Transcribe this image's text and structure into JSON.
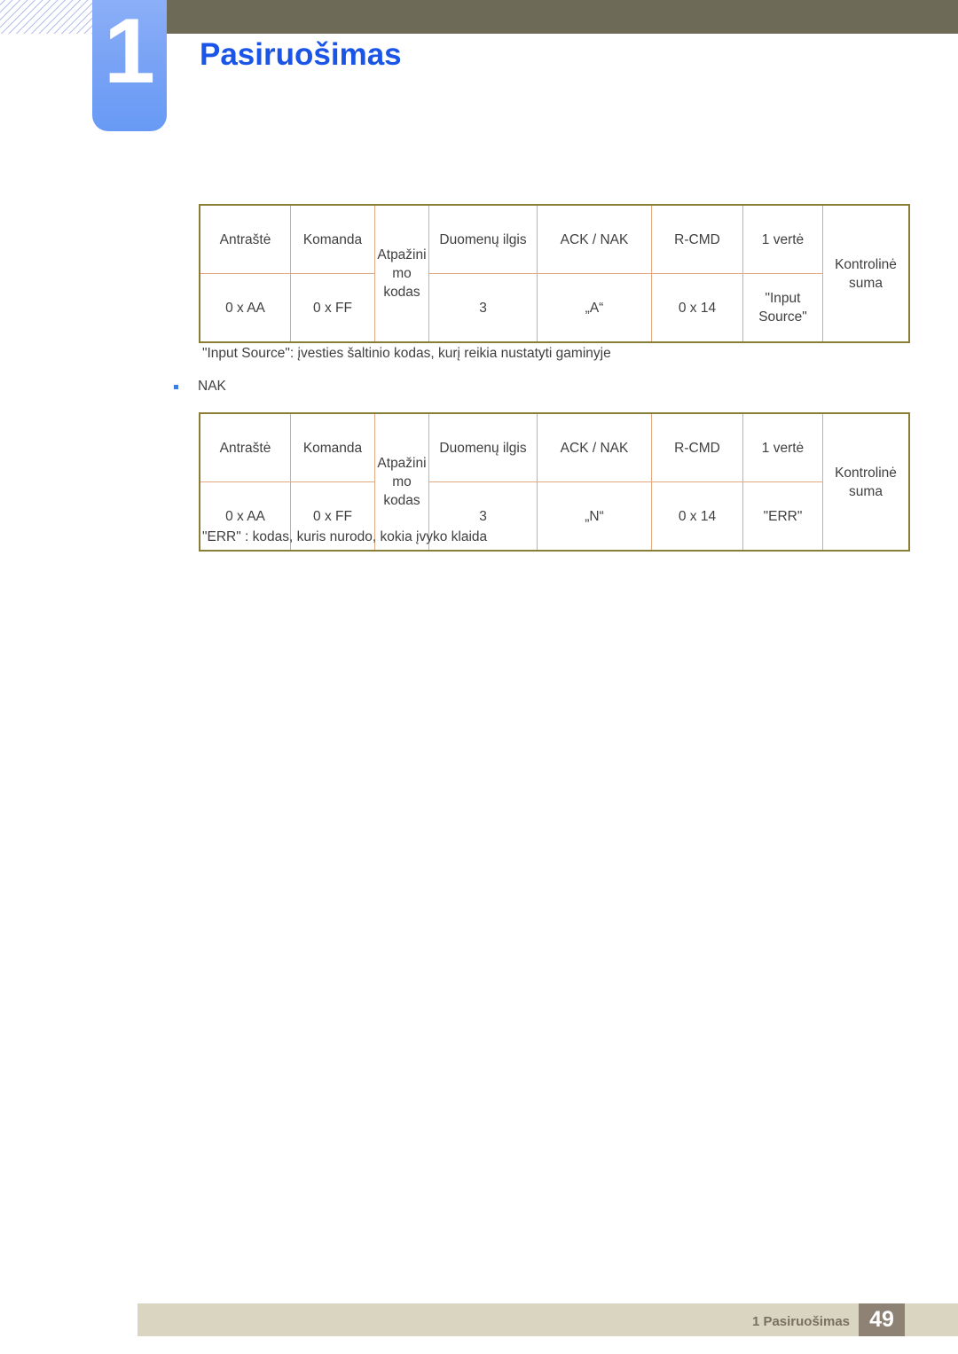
{
  "chapter": {
    "number": "1",
    "title": "Pasiruošimas"
  },
  "tables": {
    "ack": {
      "headers": {
        "c1": "Antraštė",
        "c2": "Komanda",
        "c3": "Atpažinimo kodas",
        "c4": "Duomenų ilgis",
        "c5": "ACK / NAK",
        "c6": "R-CMD",
        "c7": "1 vertė",
        "c8": "Kontrolinė suma"
      },
      "values": {
        "c1": "0 x AA",
        "c2": "0 x FF",
        "c4": "3",
        "c5": "„A“",
        "c6": "0 x 14",
        "c7": "\"Input Source\""
      }
    },
    "nak": {
      "headers": {
        "c1": "Antraštė",
        "c2": "Komanda",
        "c3": "Atpažinimo kodas",
        "c4": "Duomenų ilgis",
        "c5": "ACK / NAK",
        "c6": "R-CMD",
        "c7": "1 vertė",
        "c8": "Kontrolinė suma"
      },
      "values": {
        "c1": "0 x AA",
        "c2": "0 x FF",
        "c4": "3",
        "c5": "„N“",
        "c6": "0 x 14",
        "c7": "\"ERR\""
      }
    }
  },
  "notes": {
    "input_source": "\"Input Source\": įvesties šaltinio kodas, kurį reikia nustatyti gaminyje",
    "err": "\"ERR\" : kodas, kuris nurodo, kokia įvyko klaida"
  },
  "bullets": {
    "nak": "NAK"
  },
  "footer": {
    "label": "1 Pasiruošimas",
    "page": "49"
  },
  "colors": {
    "header_bar": "#6d6b58",
    "chapter_tab": "#7aa3f5",
    "title_blue": "#1a55e8",
    "table_outer_border": "#8a7d35",
    "table_inner_border": "#e2a882",
    "footer_bar": "#d9d5c1",
    "footer_page_box": "#8d8274",
    "bullet": "#3d7de0"
  }
}
